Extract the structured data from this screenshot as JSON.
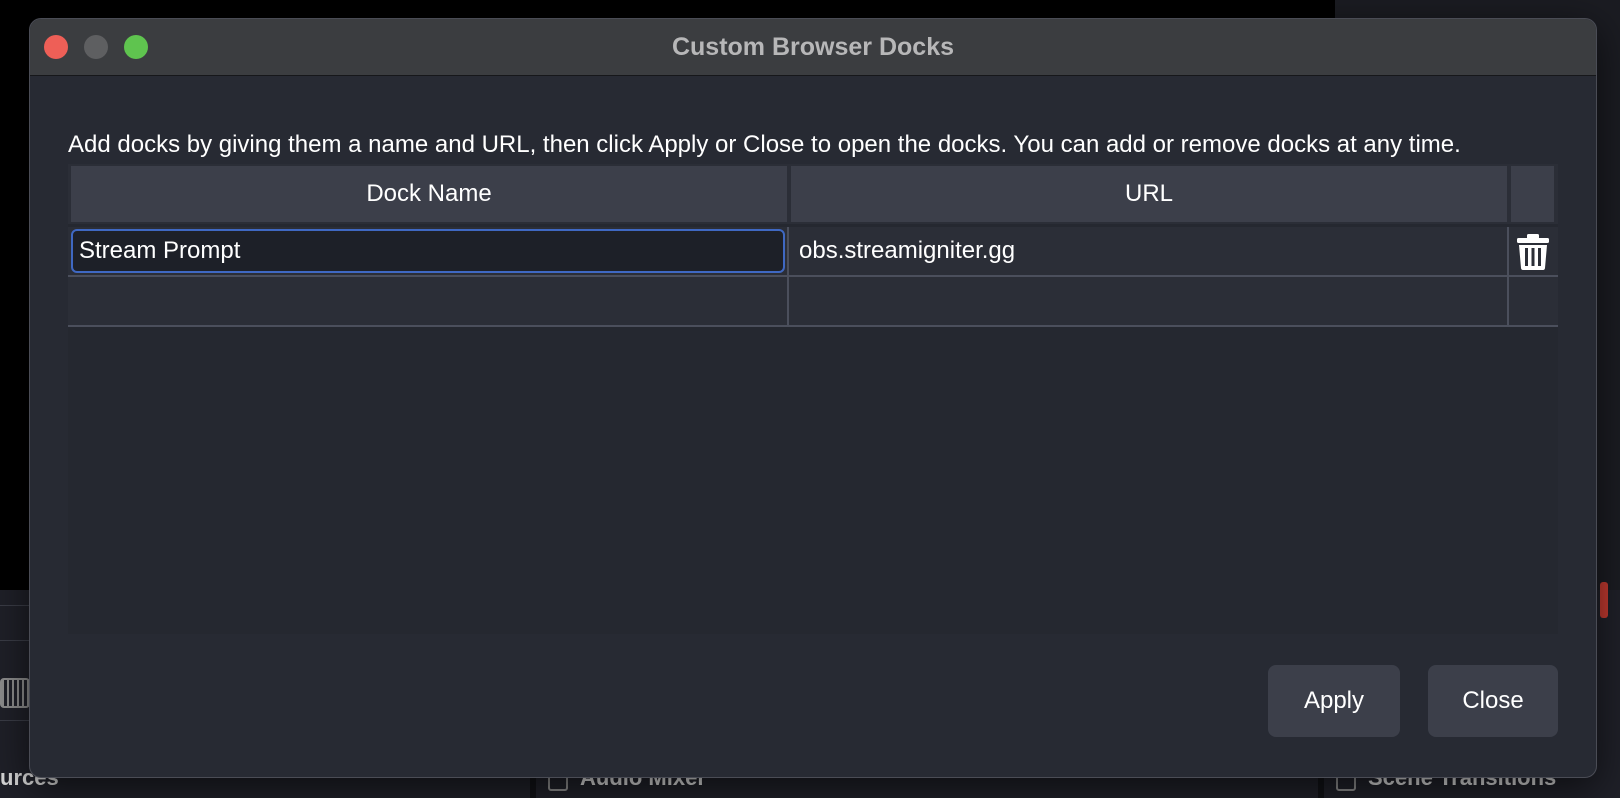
{
  "dialog": {
    "title": "Custom Browser Docks",
    "instructions": "Add docks by giving them a name and URL, then click Apply or Close to open the docks. You can add or remove docks at any time."
  },
  "table": {
    "columns": {
      "name": "Dock Name",
      "url": "URL"
    },
    "rows": [
      {
        "name": "Stream Prompt",
        "url": "obs.streamigniter.gg",
        "action_icon": "trash-icon"
      },
      {
        "name": "",
        "url": ""
      }
    ]
  },
  "buttons": {
    "apply": "Apply",
    "close": "Close"
  },
  "background": {
    "left_label": "urces",
    "center_label": "Audio Mixer",
    "right_label": "Scene Transitions"
  },
  "colors": {
    "focus_border": "#3f68c2",
    "traffic_close": "#ee5f57",
    "traffic_max": "#5fc44f"
  }
}
